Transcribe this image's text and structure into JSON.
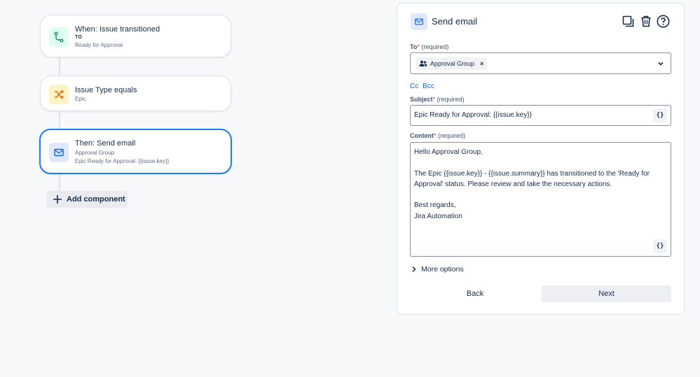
{
  "rule": {
    "trigger": {
      "title": "When: Issue transitioned",
      "to_label": "TO",
      "status": "Ready for Approval"
    },
    "condition": {
      "title": "Issue Type equals",
      "value": "Epic"
    },
    "action": {
      "title": "Then: Send email",
      "recipient": "Approval Group",
      "subject": "Epic Ready for Approval: {{issue.key}}"
    },
    "add_component_label": "Add component"
  },
  "panel": {
    "title": "Send email",
    "to": {
      "label": "To",
      "required_star": "*",
      "required_note": "(required)",
      "chip": "Approval Group",
      "chip_remove": "×"
    },
    "cc_label": "Cc",
    "bcc_label": "Bcc",
    "subject": {
      "label": "Subject",
      "required_star": "*",
      "required_note": "(required)",
      "value": "Epic Ready for Approval: {{issue.key}}",
      "smart_value_button": "{}"
    },
    "content": {
      "label": "Content",
      "required_star": "*",
      "required_note": "(required)",
      "line1": "Hello Approval Group,",
      "line2": "The Epic {{issue.key}} - {{issue.summary}} has transitioned to the 'Ready for",
      "line3": "Approval' status. Please review and take the necessary actions.",
      "line4": "Best regards,",
      "line5": "Jira Automation",
      "smart_value_button": "{}"
    },
    "more_options": "More options",
    "back": "Back",
    "next": "Next"
  },
  "colors": {
    "accent": "#1d7afc",
    "link": "#0c66e4",
    "trigger_icon_bg": "#dcfff1",
    "condition_icon_bg": "#fff3c4",
    "action_icon_bg": "#dfe9fb"
  },
  "icons": [
    "branch-icon",
    "shuffle-icon",
    "mail-icon",
    "plus-icon",
    "copy-icon",
    "trash-icon",
    "help-icon",
    "people-icon",
    "chevron-down-icon",
    "chevron-right-icon"
  ]
}
